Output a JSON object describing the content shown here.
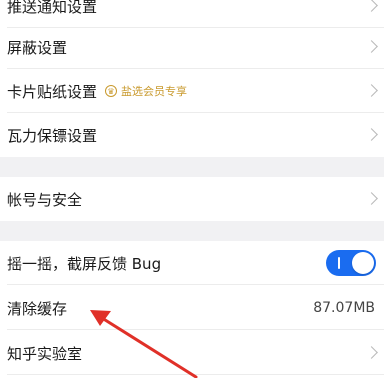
{
  "settings": {
    "push_notifications": "推送通知设置",
    "block_settings": "屏蔽设置",
    "card_sticker": {
      "label": "卡片贴纸设置",
      "badge_icon": "crown-icon",
      "badge_text": "盐选会员专享"
    },
    "wali_guard": "瓦力保镖设置",
    "account_security": "帐号与安全",
    "shake_feedback": {
      "label": "摇一摇，截屏反馈 Bug",
      "enabled": true
    },
    "clear_cache": {
      "label": "清除缓存",
      "value": "87.07MB"
    },
    "lab": "知乎实验室"
  },
  "colors": {
    "toggle_on": "#1a6cf0",
    "badge": "#c99a2e",
    "annotation_arrow": "#e03028",
    "section_gap": "#f1f1f3"
  }
}
